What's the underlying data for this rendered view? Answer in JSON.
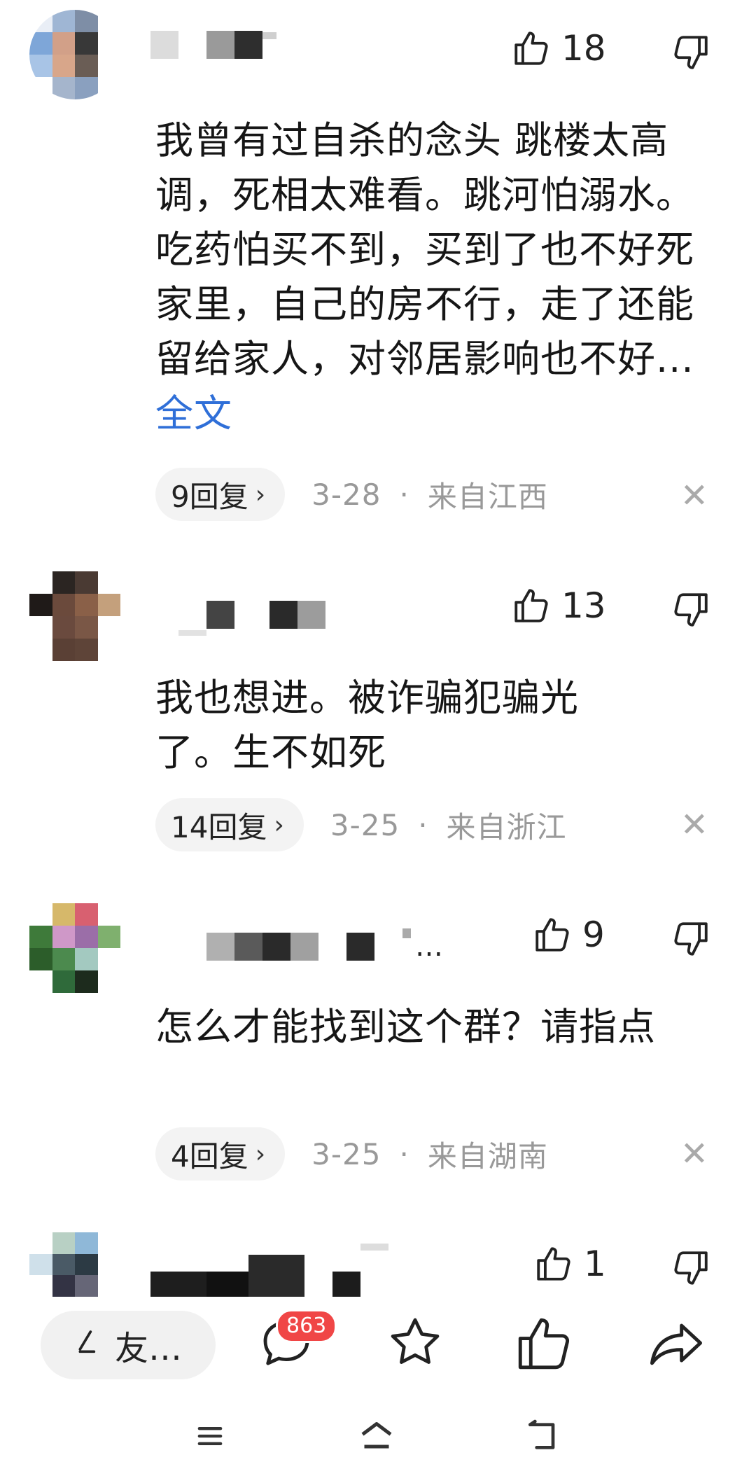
{
  "comments": [
    {
      "likes": "18",
      "text": "我曾有过自杀的念头 跳楼太高调，死相太难看。跳河怕溺水。吃药怕买不到，买到了也不好死家里，自己的房不行，走了还能留给家人，对邻居影响也不好...",
      "more_label": "全文",
      "replies": "9回复",
      "date": "3-28",
      "location": "来自江西"
    },
    {
      "likes": "13",
      "text": "我也想进。被诈骗犯骗光了。生不如死",
      "replies": "14回复",
      "date": "3-25",
      "location": "来自浙江"
    },
    {
      "likes": "9",
      "nick_suffix": "…",
      "text": "怎么才能找到这个群？请指点",
      "replies": "4回复",
      "date": "3-25",
      "location": "来自湖南"
    },
    {
      "likes": "1"
    }
  ],
  "separator": "·",
  "reply_chevron": "›",
  "close_glyph": "✕",
  "bottom_bar": {
    "friend_label": "友…",
    "comment_count": "863",
    "icons": [
      "pen-icon",
      "comment-icon",
      "star-icon",
      "thumb-up-icon",
      "share-icon"
    ]
  },
  "system_nav": {
    "icons": [
      "menu-icon",
      "home-icon",
      "back-icon"
    ]
  },
  "colors": {
    "link": "#2f6fd8",
    "meta_gray": "#999999",
    "badge_red": "#f04646"
  }
}
